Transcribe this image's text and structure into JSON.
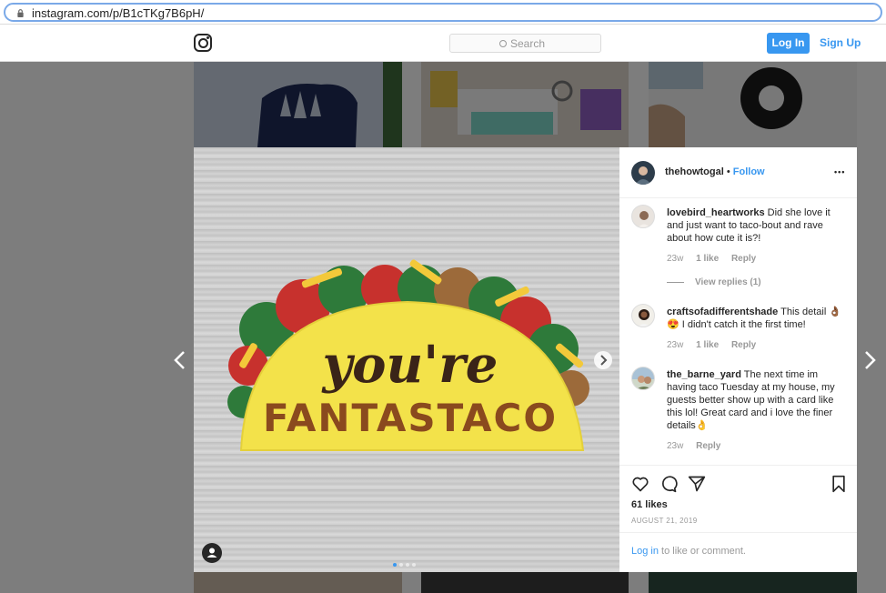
{
  "browser": {
    "url": "instagram.com/p/B1cTKg7B6pH/"
  },
  "header": {
    "search_placeholder": "Search",
    "login_label": "Log In",
    "signup_label": "Sign Up"
  },
  "post": {
    "image_text": {
      "line1": "you're",
      "line2": "FANTASTACO"
    },
    "author": "thehowtogal",
    "separator": "•",
    "follow_label": "Follow",
    "more_label": "•••",
    "likes": "61 likes",
    "date": "AUGUST 21, 2019",
    "login_prompt_link": "Log in",
    "login_prompt_rest": " to like or comment."
  },
  "comments": [
    {
      "username": "lovebird_heartworks",
      "text": " Did she love it and just want to taco-bout and rave about how cute it is?!",
      "age": "23w",
      "likes": "1 like",
      "reply": "Reply",
      "view_replies": "View replies (1)"
    },
    {
      "username": "craftsofadifferentshade",
      "text": " This detail 👌🏾 😍 I didn't catch it the first time!",
      "age": "23w",
      "likes": "1 like",
      "reply": "Reply"
    },
    {
      "username": "the_barne_yard",
      "text": " The next time im having taco Tuesday at my house, my guests better show up with a card like this lol! Great card and i love the finer details👌",
      "age": "23w",
      "reply": "Reply"
    }
  ],
  "carousel": {
    "count": 4,
    "active": 0
  },
  "colors": {
    "accent": "#3897f0",
    "taco_shell": "#f3e24a",
    "overlay": "rgba(0,0,0,0.5)"
  },
  "icons": [
    "lock-icon",
    "instagram-logo-icon",
    "search-icon",
    "more-icon",
    "heart-icon",
    "comment-icon",
    "share-icon",
    "bookmark-icon",
    "chevron-left-icon",
    "chevron-right-icon",
    "user-tag-icon"
  ]
}
